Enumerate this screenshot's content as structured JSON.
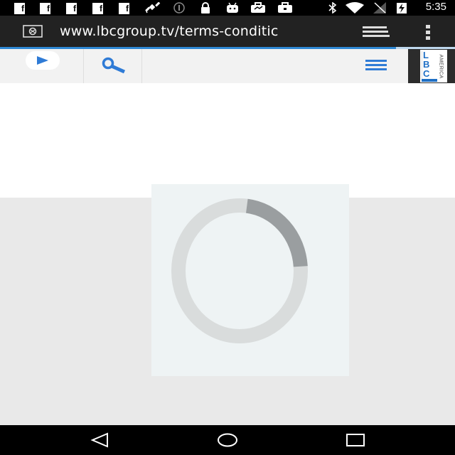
{
  "status_bar": {
    "time": "5:35",
    "notification_icons": [
      "facebook-icon",
      "facebook-icon",
      "facebook-icon",
      "facebook-icon",
      "facebook-icon",
      "satellite-icon",
      "info-icon",
      "lock-icon",
      "android-icon",
      "briefcase-icon",
      "briefcase-icon"
    ],
    "system_icons": [
      "bluetooth-icon",
      "wifi-icon",
      "signal-icon",
      "battery-charging-icon"
    ]
  },
  "browser": {
    "url": "www.lbcgroup.tv/terms-conditic",
    "load_progress": 0.87
  },
  "site_header": {
    "logo_letters": [
      "L",
      "B",
      "C"
    ],
    "logo_subtitle": "AMERICA",
    "colors": {
      "logo_bg": "#2c2c2c",
      "logo_accent": "#1f6fc4",
      "icon_blue": "#2f7bd6"
    }
  },
  "loader": {
    "fraction": 0.22
  },
  "nav_bar": {
    "buttons": [
      "back",
      "home",
      "recents"
    ]
  }
}
